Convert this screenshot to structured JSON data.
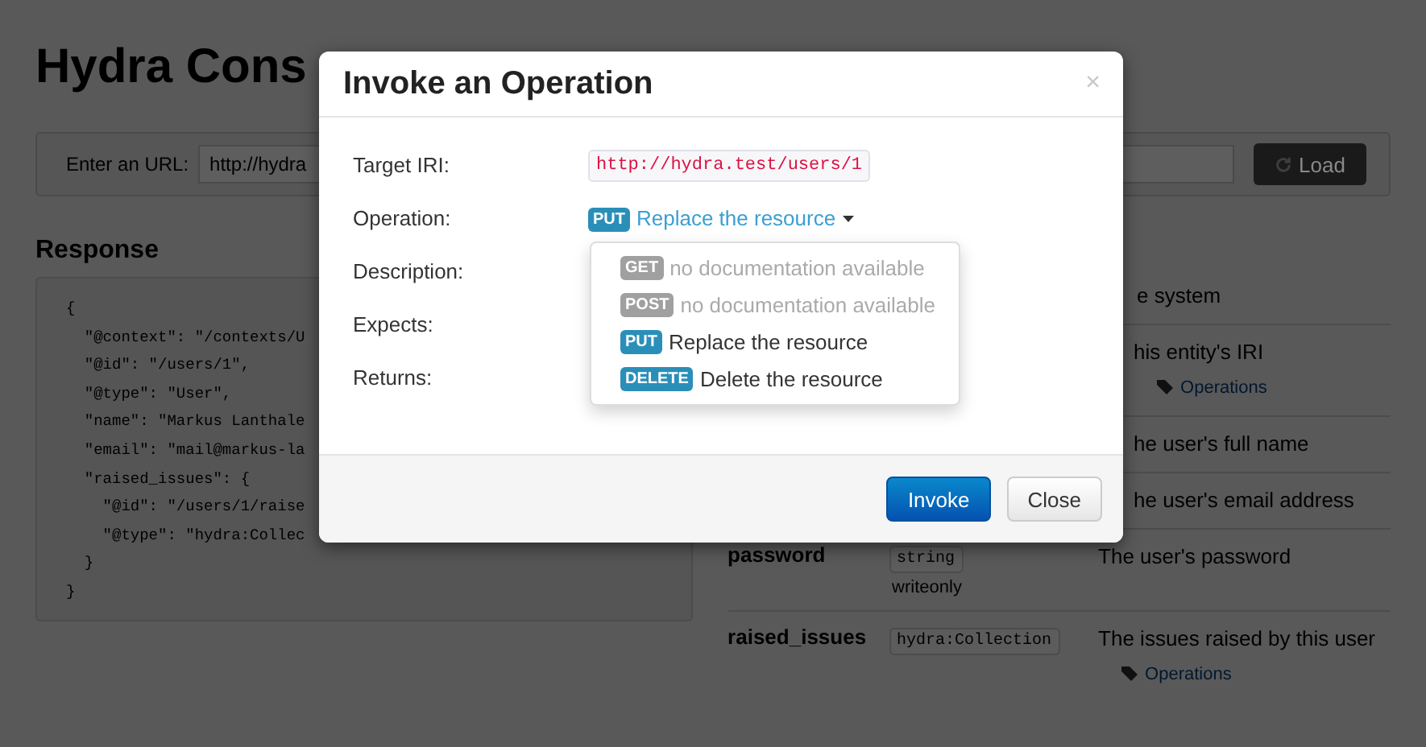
{
  "page": {
    "title": "Hydra Cons",
    "url_bar": {
      "label": "Enter an URL:",
      "value": "http://hydra",
      "button": "Load"
    },
    "response": {
      "heading": "Response",
      "code": "{\n  \"@context\": \"/contexts/U\n  \"@id\": \"/users/1\",\n  \"@type\": \"User\",\n  \"name\": \"Markus Lanthale\n  \"email\": \"mail@markus-la\n  \"raised_issues\": {\n    \"@id\": \"/users/1/raise\n    \"@type\": \"hydra:Collec\n  }\n}"
    },
    "class_description": "e system",
    "properties": [
      {
        "description": "his entity's IRI",
        "link": "Operations"
      },
      {
        "description": "he user's full name"
      },
      {
        "description": "he user's email address"
      },
      {
        "name": "password",
        "type": "string",
        "note": "writeonly",
        "description": "The user's password"
      },
      {
        "name": "raised_issues",
        "type": "hydra:Collection",
        "description": "The issues raised by this user",
        "link": "Operations"
      }
    ]
  },
  "modal": {
    "title": "Invoke an Operation",
    "close": "×",
    "fields": [
      {
        "label": "Target IRI:",
        "kind": "iri",
        "value": "http://hydra.test/users/1"
      },
      {
        "label": "Operation:",
        "kind": "operation"
      },
      {
        "label": "Description:",
        "kind": "empty"
      },
      {
        "label": "Expects:",
        "kind": "empty"
      },
      {
        "label": "Returns:",
        "kind": "empty"
      }
    ],
    "operation": {
      "method": "PUT",
      "title": "Replace the resource",
      "expanded": true,
      "menu": [
        {
          "method": "GET",
          "text": "no documentation available",
          "disabled": true
        },
        {
          "method": "POST",
          "text": "no documentation available",
          "disabled": true
        },
        {
          "method": "PUT",
          "text": "Replace the resource",
          "disabled": false
        },
        {
          "method": "DELETE",
          "text": "Delete the resource",
          "disabled": false
        }
      ]
    },
    "buttons": [
      {
        "label": "Invoke",
        "kind": "primary"
      },
      {
        "label": "Close",
        "kind": "default"
      }
    ]
  }
}
